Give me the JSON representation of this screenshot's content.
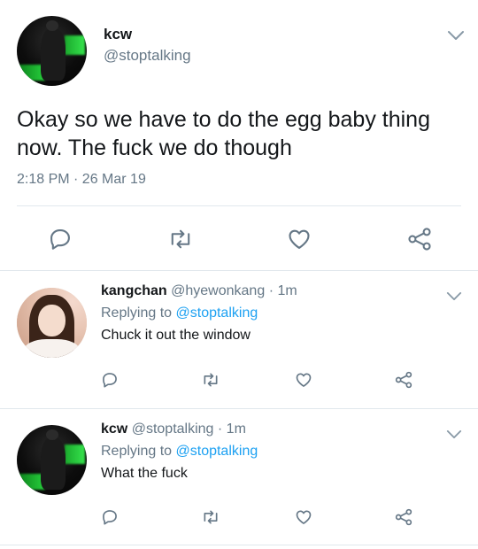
{
  "main_tweet": {
    "display_name": "kcw",
    "handle": "@stoptalking",
    "text_line1": "Okay so we have to do the egg baby thing",
    "text_line2": "now. The fuck we do though",
    "timestamp": "2:18 PM · 26 Mar 19",
    "actions": [
      "reply-icon",
      "retweet-icon",
      "like-icon",
      "share-icon"
    ]
  },
  "replies": [
    {
      "display_name": "kangchan",
      "handle": "@hyewonkang",
      "time": "· 1m",
      "replying_prefix": "Replying to",
      "replying_to": "@stoptalking",
      "text": "Chuck it out the window"
    },
    {
      "display_name": "kcw",
      "handle": "@stoptalking",
      "time": "· 1m",
      "replying_prefix": "Replying to",
      "replying_to": "@stoptalking",
      "text": "What the fuck"
    }
  ],
  "colors": {
    "link": "#1da1f2",
    "secondary_text": "#657786",
    "icon": "#657786",
    "divider": "#e1e8ed"
  }
}
